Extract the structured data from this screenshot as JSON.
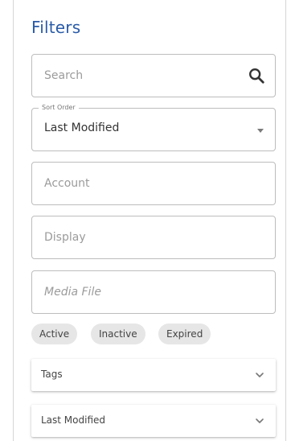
{
  "filters": {
    "title": "Filters",
    "search": {
      "placeholder": "Search",
      "icon": "search-icon"
    },
    "sort_order": {
      "legend": "Sort Order",
      "value": "Last Modified",
      "icon": "caret-down-icon"
    },
    "account": {
      "placeholder": "Account"
    },
    "display": {
      "placeholder": "Display"
    },
    "media_file": {
      "placeholder": "Media File"
    },
    "status_chips": [
      "Active",
      "Inactive",
      "Expired"
    ],
    "accordions": [
      {
        "label": "Tags",
        "icon": "chevron-down-icon"
      },
      {
        "label": "Last Modified",
        "icon": "chevron-down-icon"
      }
    ]
  },
  "colors": {
    "title": "#2a5ba8",
    "border": "#bdbdbd",
    "chip_bg": "#e6e6e6",
    "placeholder": "#9b9b9b"
  }
}
